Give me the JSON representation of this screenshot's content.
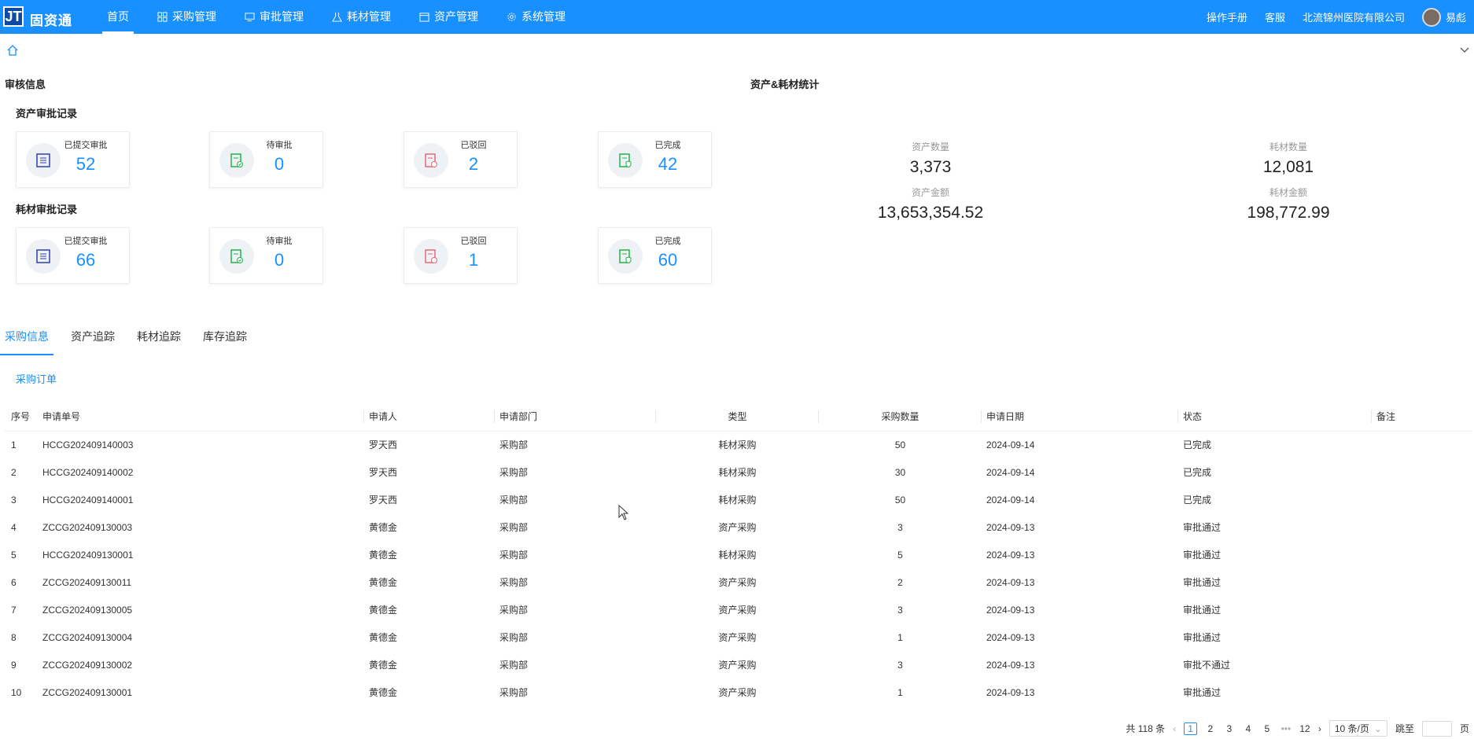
{
  "header": {
    "logo_text": "JT",
    "brand": "固资通",
    "nav": [
      {
        "label": "首页",
        "icon": "home"
      },
      {
        "label": "采购管理",
        "icon": "cart-icon"
      },
      {
        "label": "审批管理",
        "icon": "monitor-icon"
      },
      {
        "label": "耗材管理",
        "icon": "flask-icon"
      },
      {
        "label": "资产管理",
        "icon": "calendar-icon"
      },
      {
        "label": "系统管理",
        "icon": "gear-icon"
      }
    ],
    "manual": "操作手册",
    "service": "客服",
    "org": "北流锦州医院有限公司",
    "user": "易彪"
  },
  "audit": {
    "title": "审核信息",
    "asset": {
      "title": "资产审批记录",
      "cards": [
        {
          "label": "已提交审批",
          "value": "52"
        },
        {
          "label": "待审批",
          "value": "0"
        },
        {
          "label": "已驳回",
          "value": "2"
        },
        {
          "label": "已完成",
          "value": "42"
        }
      ]
    },
    "consumable": {
      "title": "耗材审批记录",
      "cards": [
        {
          "label": "已提交审批",
          "value": "66"
        },
        {
          "label": "待审批",
          "value": "0"
        },
        {
          "label": "已驳回",
          "value": "1"
        },
        {
          "label": "已完成",
          "value": "60"
        }
      ]
    }
  },
  "stats": {
    "title": "资产&耗材统计",
    "asset_count_label": "资产数量",
    "asset_count": "3,373",
    "asset_amount_label": "资产金额",
    "asset_amount": "13,653,354.52",
    "consumable_count_label": "耗材数量",
    "consumable_count": "12,081",
    "consumable_amount_label": "耗材金额",
    "consumable_amount": "198,772.99"
  },
  "tabs": [
    "采购信息",
    "资产追踪",
    "耗材追踪",
    "库存追踪"
  ],
  "subtab": "采购订单",
  "table": {
    "headers": [
      "序号",
      "申请单号",
      "申请人",
      "申请部门",
      "类型",
      "采购数量",
      "申请日期",
      "状态",
      "备注"
    ],
    "rows": [
      [
        "1",
        "HCCG202409140003",
        "罗天西",
        "采购部",
        "耗材采购",
        "50",
        "2024-09-14",
        "已完成",
        ""
      ],
      [
        "2",
        "HCCG202409140002",
        "罗天西",
        "采购部",
        "耗材采购",
        "30",
        "2024-09-14",
        "已完成",
        ""
      ],
      [
        "3",
        "HCCG202409140001",
        "罗天西",
        "采购部",
        "耗材采购",
        "50",
        "2024-09-14",
        "已完成",
        ""
      ],
      [
        "4",
        "ZCCG202409130003",
        "黄德金",
        "采购部",
        "资产采购",
        "3",
        "2024-09-13",
        "审批通过",
        ""
      ],
      [
        "5",
        "HCCG202409130001",
        "黄德金",
        "采购部",
        "耗材采购",
        "5",
        "2024-09-13",
        "审批通过",
        ""
      ],
      [
        "6",
        "ZCCG202409130011",
        "黄德金",
        "采购部",
        "资产采购",
        "2",
        "2024-09-13",
        "审批通过",
        ""
      ],
      [
        "7",
        "ZCCG202409130005",
        "黄德金",
        "采购部",
        "资产采购",
        "3",
        "2024-09-13",
        "审批通过",
        ""
      ],
      [
        "8",
        "ZCCG202409130004",
        "黄德金",
        "采购部",
        "资产采购",
        "1",
        "2024-09-13",
        "审批通过",
        ""
      ],
      [
        "9",
        "ZCCG202409130002",
        "黄德金",
        "采购部",
        "资产采购",
        "3",
        "2024-09-13",
        "审批不通过",
        ""
      ],
      [
        "10",
        "ZCCG202409130001",
        "黄德金",
        "采购部",
        "资产采购",
        "1",
        "2024-09-13",
        "审批通过",
        ""
      ]
    ]
  },
  "pagination": {
    "total": "共 118 条",
    "pages": [
      "1",
      "2",
      "3",
      "4",
      "5"
    ],
    "ellipsis": "•••",
    "last": "12",
    "size": "10 条/页",
    "jump_label": "跳至",
    "page_suffix": "页"
  },
  "colors": {
    "primary": "#1890ff",
    "submitted": "#2f3fb0",
    "pending": "#24b24d",
    "rejected": "#e8667a",
    "done": "#24b24d"
  }
}
